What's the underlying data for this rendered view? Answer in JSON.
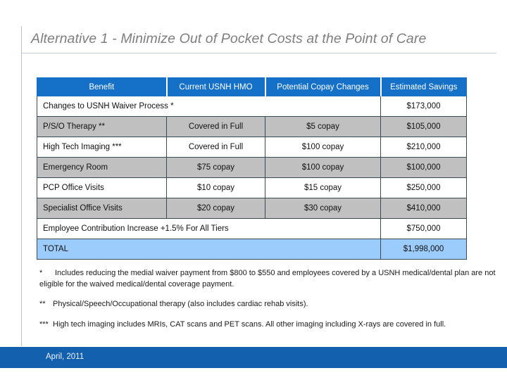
{
  "slide": {
    "title": "Alternative 1 - Minimize Out of Pocket Costs at the Point of Care"
  },
  "table": {
    "headers": {
      "benefit": "Benefit",
      "current": "Current USNH HMO",
      "potential": "Potential Copay Changes",
      "savings": "Estimated Savings"
    },
    "rows": [
      {
        "benefit": "Changes to USNH Waiver Process *",
        "current": "",
        "potential": "",
        "savings": "$173,000",
        "merged": true,
        "shade": "white"
      },
      {
        "benefit": "P/S/O Therapy **",
        "current": "Covered in Full",
        "potential": "$5 copay",
        "savings": "$105,000",
        "merged": false,
        "shade": "gray"
      },
      {
        "benefit": "High Tech Imaging ***",
        "current": "Covered in Full",
        "potential": "$100 copay",
        "savings": "$210,000",
        "merged": false,
        "shade": "white"
      },
      {
        "benefit": "Emergency Room",
        "current": "$75 copay",
        "potential": "$100 copay",
        "savings": "$100,000",
        "merged": false,
        "shade": "gray"
      },
      {
        "benefit": "PCP Office Visits",
        "current": "$10 copay",
        "potential": "$15 copay",
        "savings": "$250,000",
        "merged": false,
        "shade": "white"
      },
      {
        "benefit": "Specialist Office Visits",
        "current": "$20 copay",
        "potential": "$30 copay",
        "savings": "$410,000",
        "merged": false,
        "shade": "gray"
      },
      {
        "benefit": "Employee Contribution Increase +1.5% For All Tiers",
        "current": "",
        "potential": "",
        "savings": "$750,000",
        "merged": true,
        "shade": "white"
      },
      {
        "benefit": "TOTAL",
        "current": "",
        "potential": "",
        "savings": "$1,998,000",
        "merged": true,
        "shade": "total"
      }
    ]
  },
  "footnotes": [
    {
      "mark": "*",
      "text": "Includes reducing the medial waiver payment from $800 to $550 and employees covered by a USNH medical/dental plan are not eligible for the waived medical/dental coverage payment."
    },
    {
      "mark": "**",
      "text": "Physical/Speech/Occupational therapy (also includes cardiac rehab visits)."
    },
    {
      "mark": "***",
      "text": "High tech imaging includes MRIs, CAT scans and PET scans.  All other imaging including X-rays are covered in full."
    }
  ],
  "footer": {
    "date": "April, 2011"
  },
  "colors": {
    "header_blue": "#1570c8",
    "total_blue": "#9cccfb",
    "row_gray": "#c0c0c0",
    "footer_blue": "#1260ae",
    "title_gray": "#7e7e7e"
  }
}
